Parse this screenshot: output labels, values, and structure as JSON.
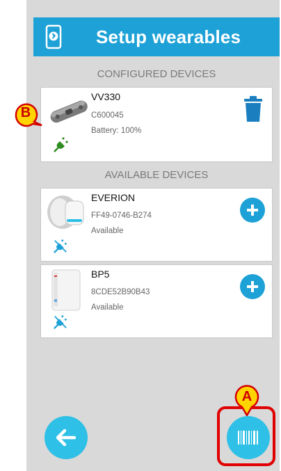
{
  "header": {
    "title": "Setup wearables",
    "icon": "bluetooth-phone-icon"
  },
  "sections": {
    "configured": "CONFIGURED DEVICES",
    "available": "AVAILABLE DEVICES"
  },
  "configured_devices": [
    {
      "name": "VV330",
      "serial": "C600045",
      "status": "Battery: 100%",
      "action_icon": "trash-icon",
      "connection_icon": "plug-connected-icon",
      "status_color": "#2e8b1f"
    }
  ],
  "available_devices": [
    {
      "name": "EVERION",
      "serial": "FF49-0746-B274",
      "status": "Available",
      "action_icon": "plus-icon",
      "connection_icon": "plug-disconnected-icon",
      "status_color": "#1da1d6"
    },
    {
      "name": "BP5",
      "serial": "8CDE52B90B43",
      "status": "Available",
      "action_icon": "plus-icon",
      "connection_icon": "plug-disconnected-icon",
      "status_color": "#1da1d6"
    }
  ],
  "footer": {
    "back_icon": "arrow-left-icon",
    "scan_icon": "barcode-icon"
  },
  "annotations": {
    "marker_a": "A",
    "marker_b": "B"
  },
  "colors": {
    "accent": "#1da1d6",
    "screen_bg": "#d9d9d9",
    "marker_fill": "#ffd400",
    "marker_stroke": "#d40000"
  }
}
